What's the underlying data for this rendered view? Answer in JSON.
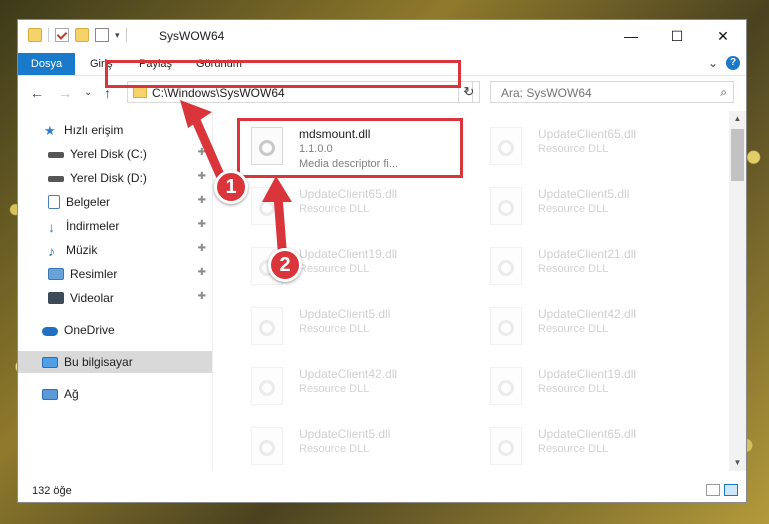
{
  "window": {
    "title": "SysWOW64",
    "buttons": {
      "minimize": "—",
      "maximize": "☐",
      "close": "✕"
    }
  },
  "ribbon": {
    "tabs": [
      "Dosya",
      "Giriş",
      "Paylaş",
      "Görünüm"
    ],
    "expand": "⌄",
    "help": "?"
  },
  "nav": {
    "back": "←",
    "forward": "→",
    "recent": "⌄",
    "up": "↑",
    "address": "C:\\Windows\\SysWOW64",
    "refresh": "↻",
    "search_placeholder": "Ara: SysWOW64",
    "search_icon": "⌕"
  },
  "sidebar": {
    "items": [
      {
        "label": "Hızlı erişim",
        "icon": "star-icon",
        "pinned": false
      },
      {
        "label": "Yerel Disk (C:)",
        "icon": "drive-icon",
        "pinned": true
      },
      {
        "label": "Yerel Disk (D:)",
        "icon": "drive-icon",
        "pinned": true
      },
      {
        "label": "Belgeler",
        "icon": "documents-icon",
        "pinned": true
      },
      {
        "label": "İndirmeler",
        "icon": "downloads-icon",
        "pinned": true
      },
      {
        "label": "Müzik",
        "icon": "music-icon",
        "pinned": true
      },
      {
        "label": "Resimler",
        "icon": "pictures-icon",
        "pinned": true
      },
      {
        "label": "Videolar",
        "icon": "videos-icon",
        "pinned": true
      },
      {
        "label": "OneDrive",
        "icon": "cloud-icon",
        "pinned": false
      },
      {
        "label": "Bu bilgisayar",
        "icon": "computer-icon",
        "pinned": false
      },
      {
        "label": "Ağ",
        "icon": "network-icon",
        "pinned": false
      }
    ],
    "pin_glyph": "📌"
  },
  "files": {
    "selected": {
      "name": "mdsmount.dll",
      "version": "1.1.0.0",
      "description": "Media descriptor fi..."
    },
    "left_column": [
      {
        "name": "UpdateClient65.dll",
        "type": "Resource DLL"
      },
      {
        "name": "UpdateClient19.dll",
        "type": "Resource DLL"
      },
      {
        "name": "UpdateClient5.dll",
        "type": "Resource DLL"
      },
      {
        "name": "UpdateClient42.dll",
        "type": "Resource DLL"
      },
      {
        "name": "UpdateClient5.dll",
        "type": "Resource DLL"
      }
    ],
    "right_column": [
      {
        "name": "UpdateClient65.dll",
        "type": "Resource DLL"
      },
      {
        "name": "UpdateClient5.dll",
        "type": "Resource DLL"
      },
      {
        "name": "UpdateClient21.dll",
        "type": "Resource DLL"
      },
      {
        "name": "UpdateClient42.dll",
        "type": "Resource DLL"
      },
      {
        "name": "UpdateClient19.dll",
        "type": "Resource DLL"
      },
      {
        "name": "UpdateClient65.dll",
        "type": "Resource DLL"
      }
    ]
  },
  "status": {
    "count": "132 öğe"
  },
  "annotations": {
    "step1": "1",
    "step2": "2",
    "color": "#d9353a"
  }
}
